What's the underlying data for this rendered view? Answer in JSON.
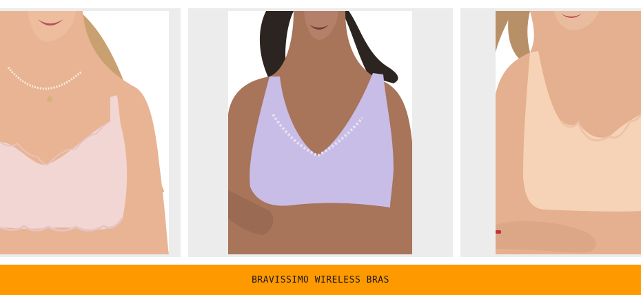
{
  "products": [
    {
      "image_label": "blush pink scalloped wireless bra",
      "bra_color": "#f1d6d4",
      "skin_color": "#e9b493",
      "hair_color": "#c9a070"
    },
    {
      "image_label": "lilac lace-trim wireless bra",
      "bra_color": "#c8bde6",
      "skin_color": "#a8745a",
      "hair_color": "#2c2420"
    },
    {
      "image_label": "nude scalloped wireless bra",
      "bra_color": "#f6d3b6",
      "skin_color": "#e5b08f",
      "hair_color": "#b89068"
    }
  ],
  "banner": {
    "title": "BRAVISSIMO WIRELESS BRAS",
    "background": "#ff9900"
  }
}
